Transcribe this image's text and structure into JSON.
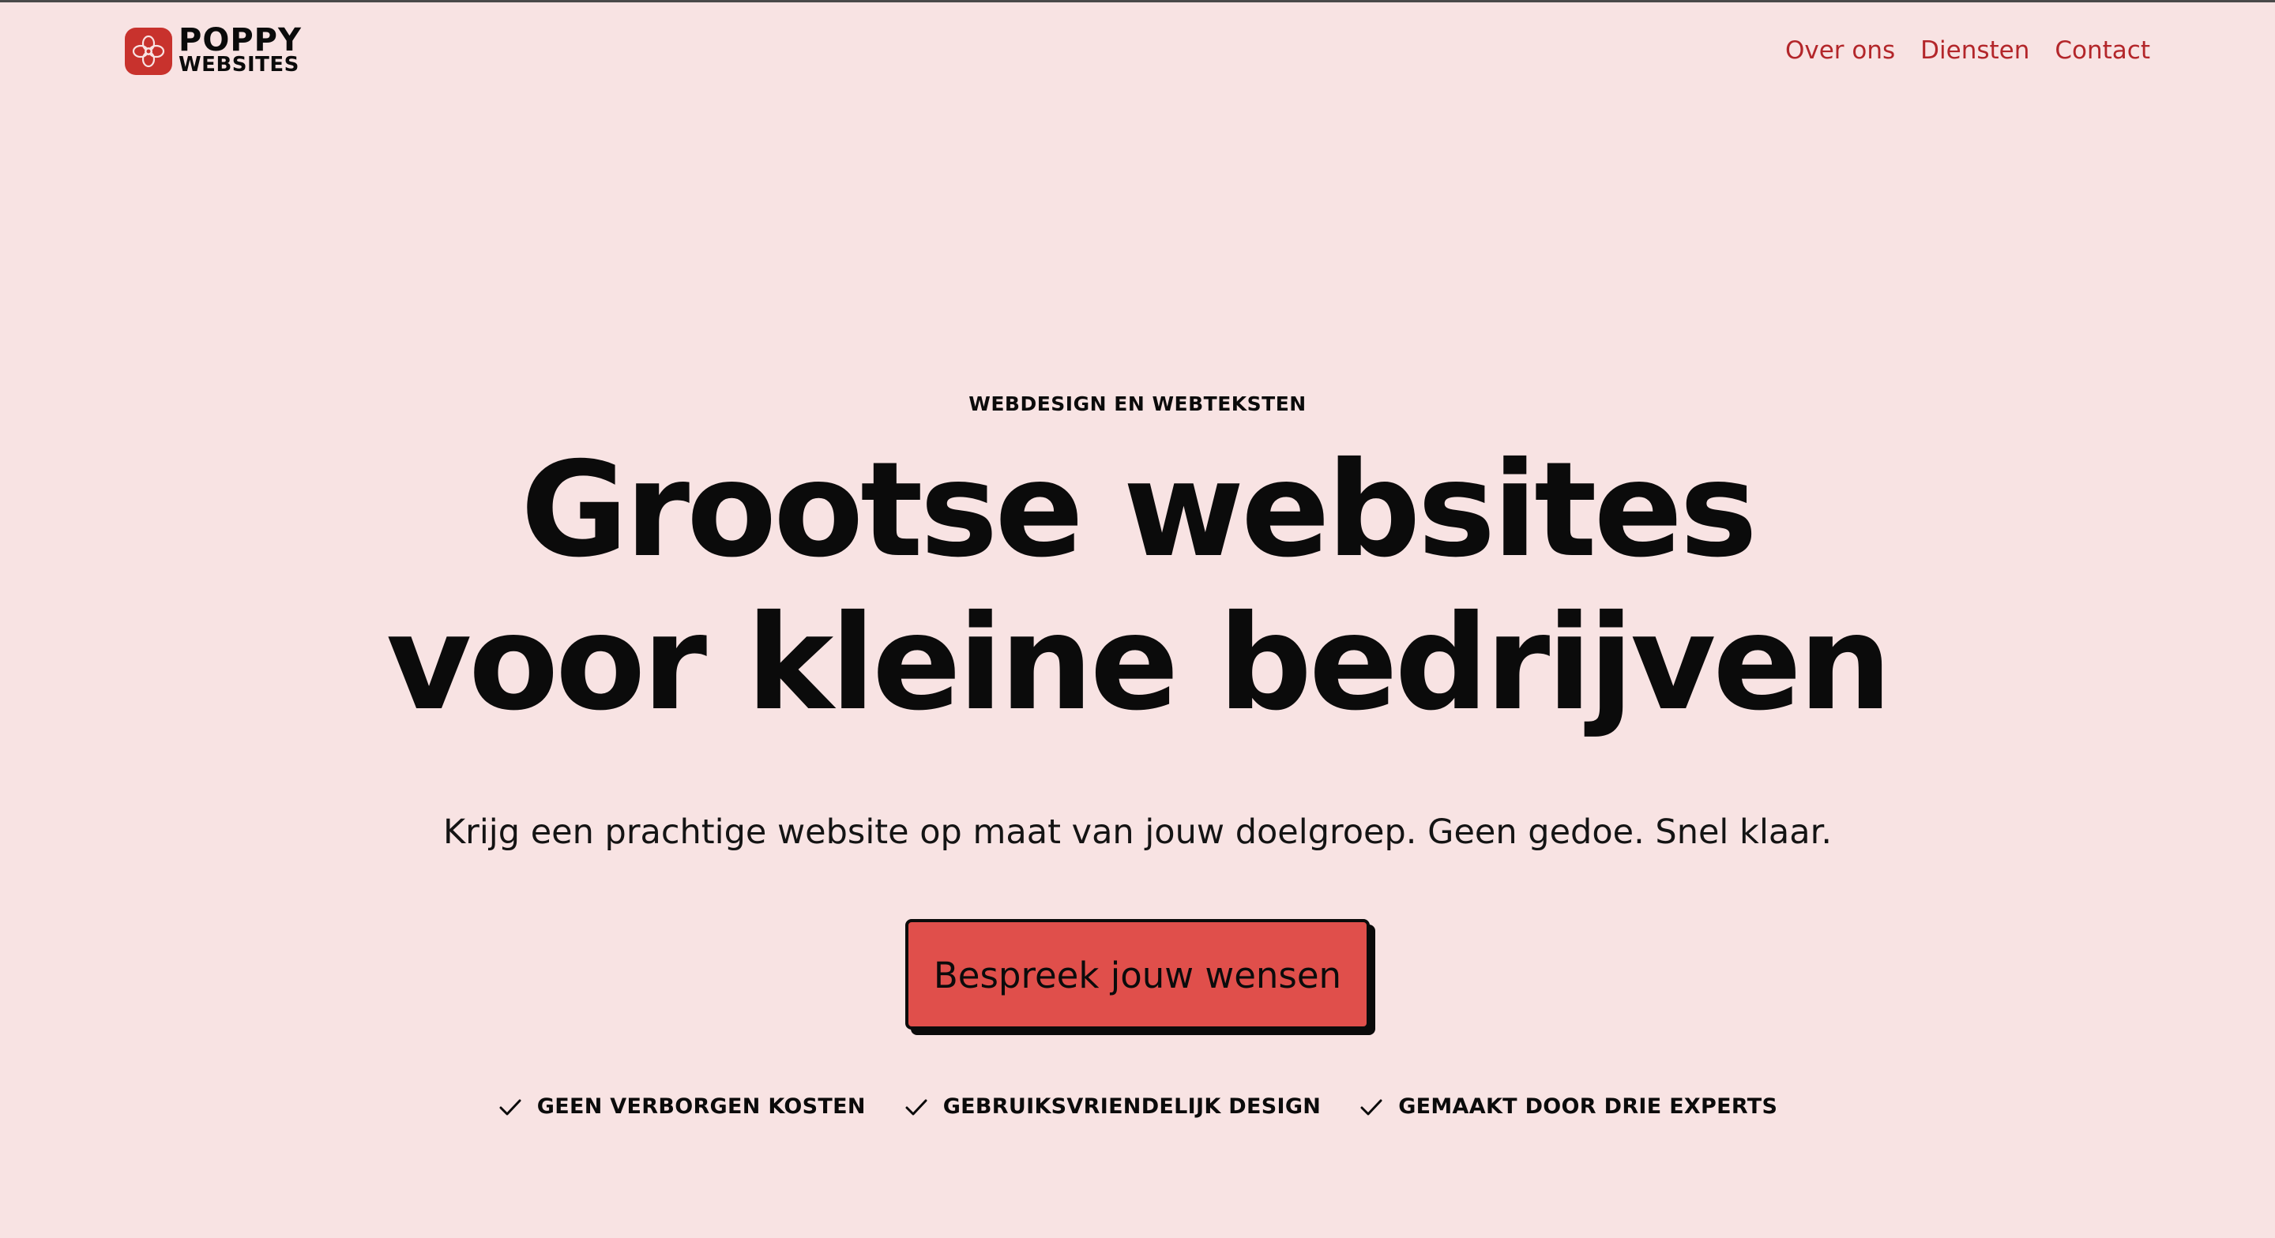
{
  "header": {
    "logo": {
      "line1": "POPPY",
      "line2": "WEBSITES",
      "icon": "poppy-flower-icon",
      "brand_color": "#c8322d"
    },
    "nav": [
      {
        "label": "Over ons"
      },
      {
        "label": "Diensten"
      },
      {
        "label": "Contact"
      }
    ],
    "nav_color": "#b3262a"
  },
  "hero": {
    "eyebrow": "WEBDESIGN EN WEBTEKSTEN",
    "headline_line1": "Grootse websites",
    "headline_line2": "voor kleine bedrijven",
    "subtitle": "Krijg een prachtige website op maat van jouw doelgroep. Geen gedoe. Snel klaar.",
    "cta_label": "Bespreek jouw wensen",
    "cta_color": "#e04f4b",
    "features": [
      {
        "label": "GEEN VERBORGEN KOSTEN",
        "icon": "check-icon"
      },
      {
        "label": "GEBRUIKSVRIENDELIJK DESIGN",
        "icon": "check-icon"
      },
      {
        "label": "GEMAAKT DOOR DRIE EXPERTS",
        "icon": "check-icon"
      }
    ]
  },
  "colors": {
    "background": "#f8e3e3",
    "text": "#0b0b0b"
  }
}
